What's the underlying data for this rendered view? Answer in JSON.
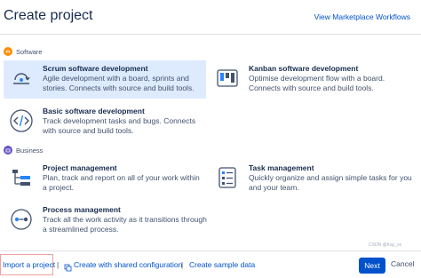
{
  "header": {
    "title": "Create project",
    "marketplace_link": "View Marketplace Workflows"
  },
  "sections": {
    "software": "Software",
    "business": "Business"
  },
  "cards": {
    "scrum": {
      "title": "Scrum software development",
      "desc": "Agile development with a board, sprints and stories. Connects with source and build tools."
    },
    "kanban": {
      "title": "Kanban software development",
      "desc": "Optimise development flow with a board. Connects with source and build tools."
    },
    "basic": {
      "title": "Basic software development",
      "desc": "Track development tasks and bugs. Connects with source and build tools."
    },
    "project_mgmt": {
      "title": "Project management",
      "desc": "Plan, track and report on all of your work within a project."
    },
    "task_mgmt": {
      "title": "Task management",
      "desc": "Quickly organize and assign simple tasks for you and your team."
    },
    "process_mgmt": {
      "title": "Process management",
      "desc": "Track all the work activity as it transitions through a streamlined process."
    }
  },
  "footer": {
    "import": "Import a project",
    "shared_config": "Create with shared configuration",
    "sample_data": "Create sample data",
    "separator": "|",
    "next": "Next",
    "cancel": "Cancel"
  },
  "watermark": "CSDN @Kay_xx",
  "colors": {
    "accent": "#0052cc",
    "software_section": "#ff8b00",
    "business_section": "#6554c0",
    "selected_card": "#deebff"
  },
  "icons": {
    "software_section": "software-icon",
    "business_section": "business-icon",
    "scrum": "scrum-loop-icon",
    "kanban": "kanban-board-icon",
    "basic": "code-icon",
    "project_mgmt": "project-tree-icon",
    "task_mgmt": "checklist-icon",
    "process_mgmt": "process-flow-icon"
  }
}
